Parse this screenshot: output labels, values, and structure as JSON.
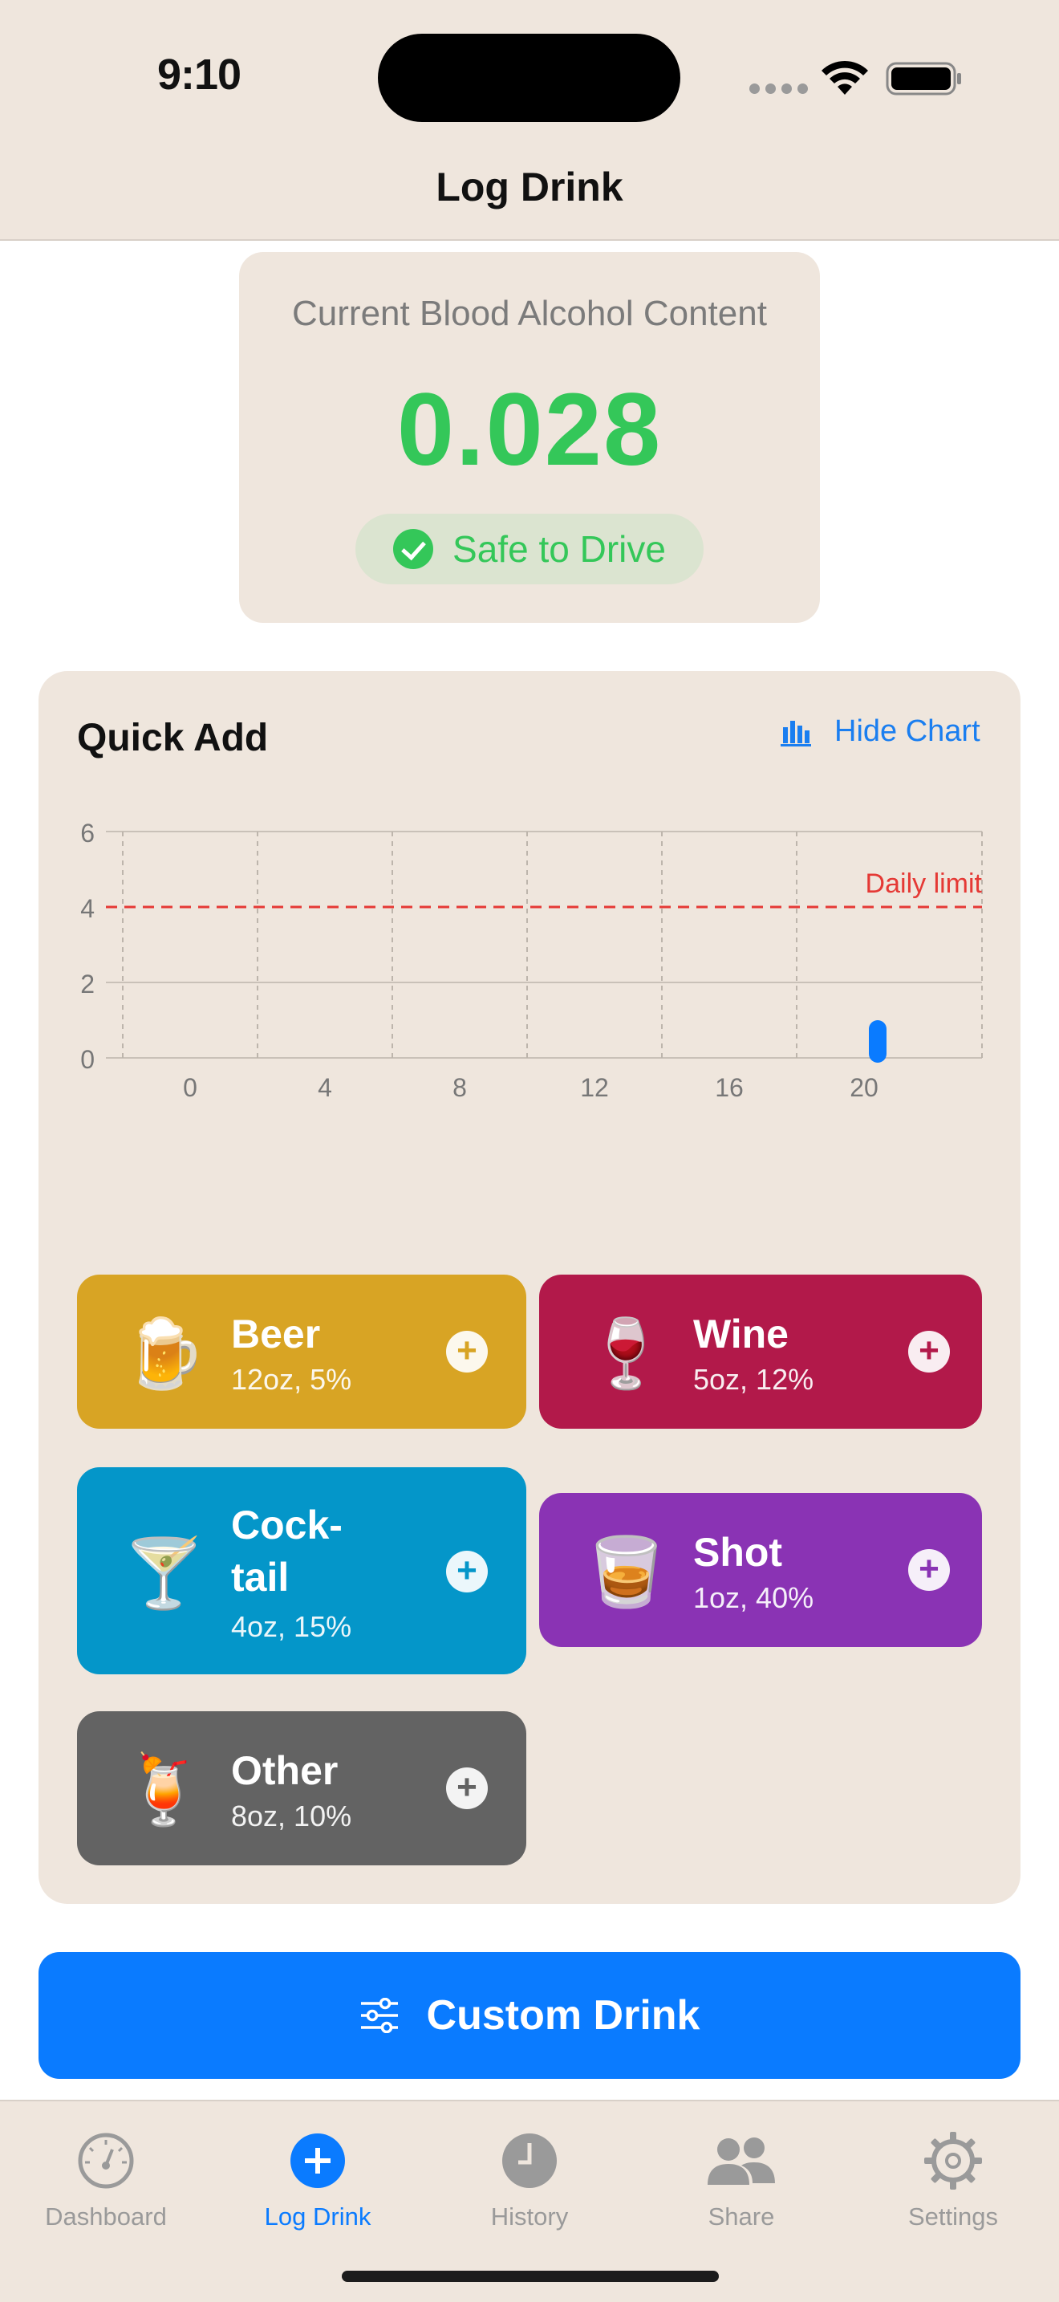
{
  "status_bar": {
    "time": "9:10"
  },
  "nav": {
    "title": "Log Drink"
  },
  "bac": {
    "label": "Current Blood Alcohol Content",
    "value": "0.028",
    "status": "Safe to Drive",
    "status_color": "#34c759"
  },
  "quick_add": {
    "title": "Quick Add",
    "toggle_chart_label": "Hide Chart",
    "drinks": [
      {
        "name": "Beer",
        "spec": "12oz, 5%",
        "emoji": "🍺",
        "color": "#d8a424"
      },
      {
        "name": "Wine",
        "spec": "5oz, 12%",
        "emoji": "🍷",
        "color": "#b2194a"
      },
      {
        "name": "Cock-\ntail",
        "spec": "4oz, 15%",
        "emoji": "🍸",
        "color": "#0496c9"
      },
      {
        "name": "Shot",
        "spec": "1oz, 40%",
        "emoji": "🥃",
        "color": "#8a33b4"
      },
      {
        "name": "Other",
        "spec": "8oz, 10%",
        "emoji": "🍹",
        "color": "#636363"
      }
    ]
  },
  "chart_data": {
    "type": "bar",
    "title": "",
    "xlabel": "",
    "ylabel": "",
    "x_ticks": [
      "0",
      "4",
      "8",
      "12",
      "16",
      "20"
    ],
    "y_ticks": [
      "0",
      "2",
      "4",
      "6"
    ],
    "xlim": [
      -2.5,
      23.5
    ],
    "ylim": [
      0,
      6
    ],
    "bars": [
      {
        "x": 20,
        "value": 1
      }
    ],
    "reference_line": {
      "y": 4,
      "label": "Daily limit",
      "color": "#e53935",
      "style": "dashed"
    },
    "bar_color": "#0a7bff",
    "grid": true
  },
  "custom_drink": {
    "label": "Custom Drink"
  },
  "tabs": [
    {
      "label": "Dashboard",
      "icon": "gauge-icon",
      "active": false
    },
    {
      "label": "Log Drink",
      "icon": "plus-circle-icon",
      "active": true
    },
    {
      "label": "History",
      "icon": "clock-icon",
      "active": false
    },
    {
      "label": "Share",
      "icon": "people-icon",
      "active": false
    },
    {
      "label": "Settings",
      "icon": "gear-icon",
      "active": false
    }
  ]
}
